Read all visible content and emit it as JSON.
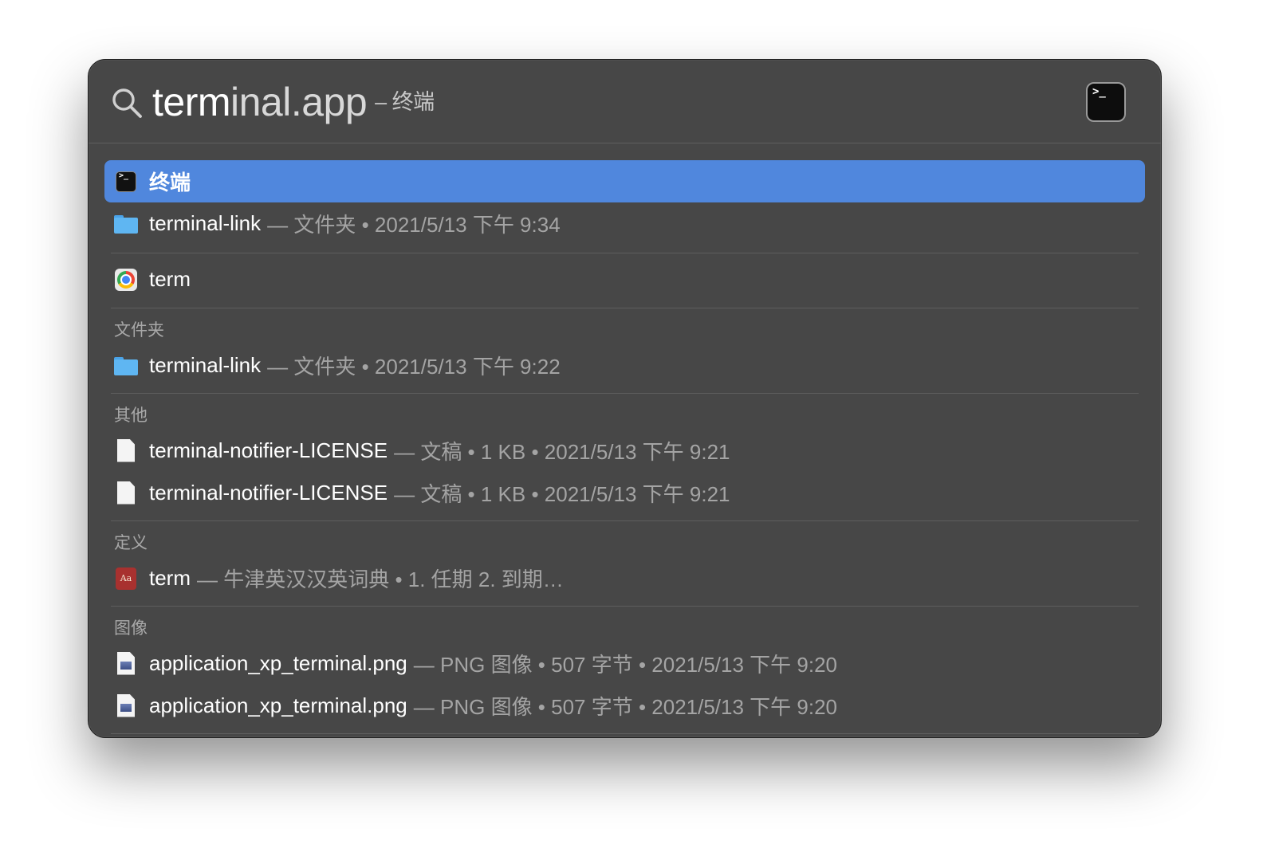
{
  "search": {
    "typed": "term",
    "completion": "inal.app",
    "hint": "– 终端",
    "preview_icon": "terminal-app-icon",
    "preview_prompt": ">_"
  },
  "results": [
    {
      "icon": "terminal-icon",
      "title": "终端",
      "meta": "",
      "selected": true
    },
    {
      "icon": "folder-icon",
      "title": "terminal-link",
      "meta": "— 文件夹 • 2021/5/13 下午 9:34"
    },
    {
      "icon": "chrome-icon",
      "title": "term",
      "meta": ""
    }
  ],
  "sections": [
    {
      "header": "文件夹",
      "items": [
        {
          "icon": "folder-icon",
          "title": "terminal-link",
          "meta": "— 文件夹 • 2021/5/13 下午 9:22"
        }
      ]
    },
    {
      "header": "其他",
      "items": [
        {
          "icon": "document-icon",
          "title": "terminal-notifier-LICENSE",
          "meta": "— 文稿 • 1 KB • 2021/5/13 下午 9:21"
        },
        {
          "icon": "document-icon",
          "title": "terminal-notifier-LICENSE",
          "meta": "— 文稿 • 1 KB • 2021/5/13 下午 9:21"
        }
      ]
    },
    {
      "header": "定义",
      "items": [
        {
          "icon": "dictionary-icon",
          "title": "term",
          "meta": "— 牛津英汉汉英词典 • 1. 任期 2. 到期…",
          "icon_text": "Aa"
        }
      ]
    },
    {
      "header": "图像",
      "items": [
        {
          "icon": "png-image-icon",
          "title": "application_xp_terminal.png",
          "meta": "— PNG 图像 • 507 字节 • 2021/5/13 下午 9:20"
        },
        {
          "icon": "png-image-icon",
          "title": "application_xp_terminal.png",
          "meta": "— PNG 图像 • 507 字节 • 2021/5/13 下午 9:20"
        }
      ]
    }
  ],
  "colors": {
    "panel": "#474747",
    "selection": "#5087dd",
    "primary_text": "#ffffff",
    "secondary_text": "#a4a4a4"
  }
}
